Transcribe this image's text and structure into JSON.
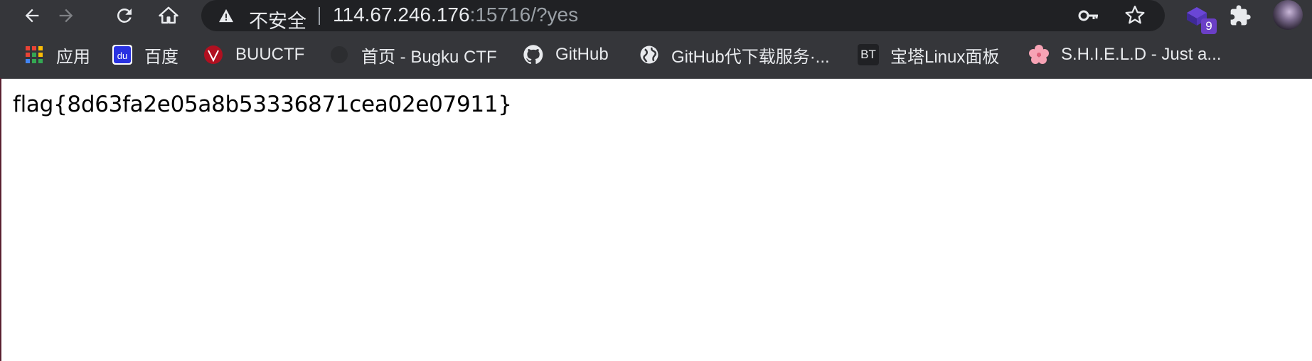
{
  "browser": {
    "security_label": "不安全",
    "url_host": "114.67.246.176",
    "url_rest": ":15716/?yes",
    "extension_badge": "9"
  },
  "bookmarks": [
    {
      "label": "应用",
      "icon": "apps-grid-icon"
    },
    {
      "label": "百度",
      "icon": "baidu-icon"
    },
    {
      "label": "BUUCTF",
      "icon": "buuctf-icon"
    },
    {
      "label": "首页 - Bugku CTF",
      "icon": "bugku-icon"
    },
    {
      "label": "GitHub",
      "icon": "github-icon"
    },
    {
      "label": "GitHub代下载服务·...",
      "icon": "globe-icon"
    },
    {
      "label": "宝塔Linux面板",
      "icon": "bt-icon",
      "icon_text": "BT"
    },
    {
      "label": "S.H.I.E.L.D - Just a...",
      "icon": "flower-icon"
    }
  ],
  "page": {
    "body_text": "flag{8d63fa2e05a8b53336871cea02e07911}"
  },
  "colors": {
    "chrome_bg": "#35363a",
    "omnibox_bg": "#202124",
    "text_light": "#e8eaed",
    "text_dim": "#9aa0a6"
  }
}
